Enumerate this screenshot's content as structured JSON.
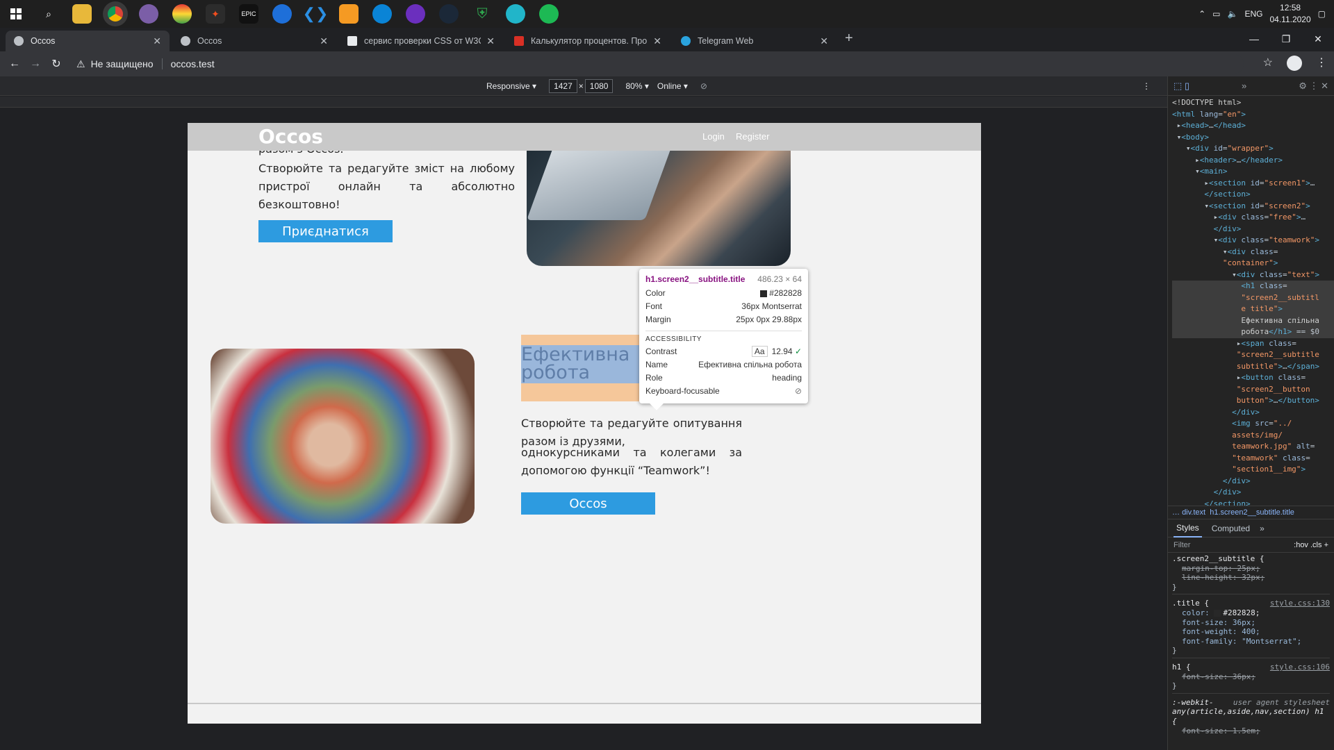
{
  "taskbar": {
    "time": "12:58",
    "date": "04.11.2020",
    "lang": "ENG"
  },
  "tabs": [
    {
      "label": "Occos",
      "active": true
    },
    {
      "label": "Occos",
      "active": false
    },
    {
      "label": "сервис проверки CSS от W3C",
      "active": false
    },
    {
      "label": "Калькулятор процентов. Проце",
      "active": false
    },
    {
      "label": "Telegram Web",
      "active": false
    }
  ],
  "address": {
    "security": "Не защищено",
    "url": "occos.test"
  },
  "device_toolbar": {
    "mode": "Responsive",
    "width": "1427",
    "height": "1080",
    "zoom": "80%",
    "network": "Online"
  },
  "site": {
    "logo": "Occos",
    "nav_login": "Login",
    "nav_register": "Register",
    "top_text_partial": "разом з Occos.",
    "top_text": "Створюйте та редагуйте зміст на любому пристрої онлайн та абсолютно безкоштовно!",
    "join_button": "Приєднатися",
    "teamwork_title": "Ефективна спільна робота",
    "teamwork_text_1": "Створюйте та редагуйте опитування разом із друзями,",
    "teamwork_text_2": "однокурсниками та колегами за допомогою функції “Teamwork”!",
    "occos_button": "Occos"
  },
  "tooltip": {
    "selector": "h1.screen2__subtitle.title",
    "size": "486.23 × 64",
    "color_label": "Color",
    "color_value": "#282828",
    "font_label": "Font",
    "font_value": "36px Montserrat",
    "margin_label": "Margin",
    "margin_value": "25px 0px 29.88px",
    "accessibility": "ACCESSIBILITY",
    "contrast_label": "Contrast",
    "contrast_value": "12.94",
    "name_label": "Name",
    "name_value": "Ефективна спільна робота",
    "role_label": "Role",
    "role_value": "heading",
    "keyboard_label": "Keyboard-focusable"
  },
  "devtools": {
    "breadcrumb_1": "div.text",
    "breadcrumb_2": "h1.screen2__subtitle.title",
    "tab_styles": "Styles",
    "tab_computed": "Computed",
    "filter": "Filter",
    "hov": ":hov",
    "cls": ".cls",
    "rule1_selector": ".screen2__subtitle {",
    "rule1_p1": "margin-top: 25px;",
    "rule1_p2": "line-height: 32px;",
    "rule2_selector": ".title {",
    "rule2_src": "style.css:130",
    "rule2_p1n": "color:",
    "rule2_p1v": "#282828;",
    "rule2_p2": "font-size: 36px;",
    "rule2_p3": "font-weight: 400;",
    "rule2_p4": "font-family: \"Montserrat\";",
    "rule3_selector": "h1 {",
    "rule3_src": "style.css:106",
    "rule3_p1": "font-size: 36px;",
    "rule4_selector": ":-webkit-any(article,aside,nav,section) h1 {",
    "rule4_src": "user agent stylesheet",
    "rule4_p1": "font-size: 1.5em;",
    "close_brace": "}"
  }
}
